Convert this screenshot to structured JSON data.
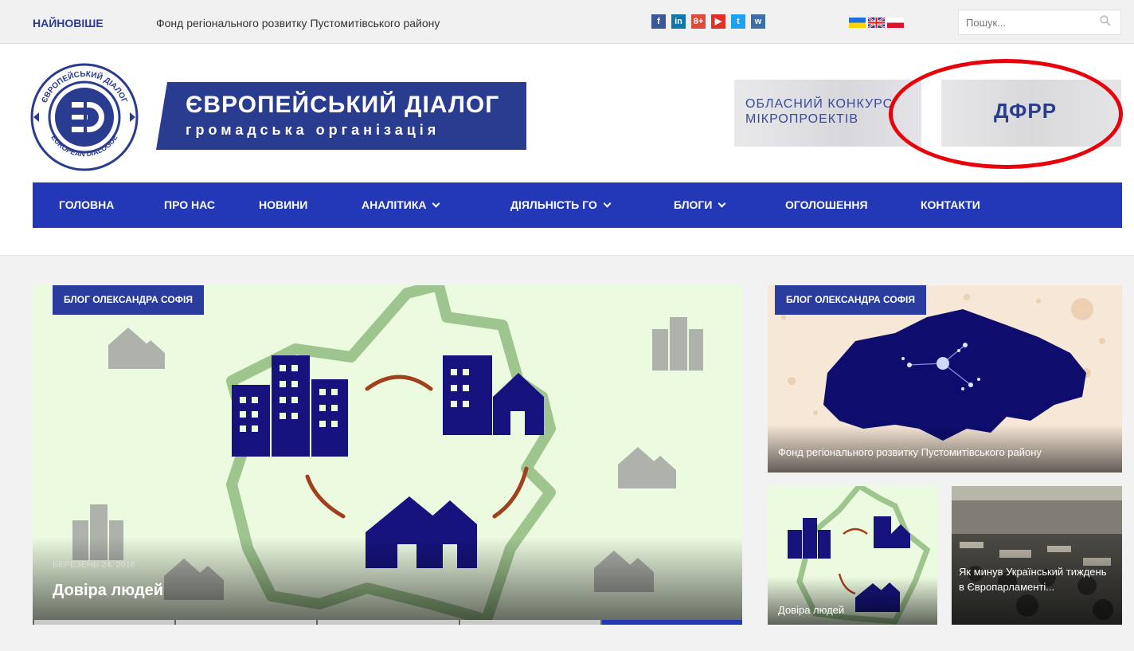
{
  "topbar": {
    "latest_label": "НАЙНОВІШЕ",
    "latest_headline": "Фонд регіонального розвитку Пустомитівського району",
    "social": [
      {
        "icon": "facebook-icon",
        "glyph": "f",
        "color": "#3b5998"
      },
      {
        "icon": "linkedin-icon",
        "glyph": "in",
        "color": "#0e76a8"
      },
      {
        "icon": "google-plus-icon",
        "glyph": "8+",
        "color": "#dd4b39"
      },
      {
        "icon": "youtube-icon",
        "glyph": "▶",
        "color": "#e52d27"
      },
      {
        "icon": "twitter-icon",
        "glyph": "t",
        "color": "#1da1f2"
      },
      {
        "icon": "vk-icon",
        "glyph": "w",
        "color": "#3e6ea7"
      }
    ],
    "flags": [
      "ukraine-flag-icon",
      "uk-flag-icon",
      "poland-flag-icon"
    ],
    "search_placeholder": "Пошук..."
  },
  "header": {
    "logo_title": "ЄВРОПЕЙСЬКИЙ ДІАЛОГ",
    "logo_subtitle": "громадська організація",
    "logo_ring_top": "ЄВРОПЕЙСЬКИЙ ДІАЛОГ",
    "logo_ring_bottom": "EUROPEAN DIALOGUE",
    "banner1": "ОБЛАСНИЙ КОНКУРС МІКРОПРОЕКТІВ",
    "banner2": "ДФРР"
  },
  "nav": {
    "items": [
      {
        "label": "ГОЛОВНА"
      },
      {
        "label": "ПРО НАС"
      },
      {
        "label": "НОВИНИ"
      },
      {
        "label": "АНАЛІТИКА"
      },
      {
        "label": "ДІЯЛЬНІСТЬ ГО"
      },
      {
        "label": "БЛОГИ"
      },
      {
        "label": "ОГОЛОШЕННЯ"
      },
      {
        "label": "КОНТАКТИ"
      }
    ]
  },
  "featured": {
    "tag": "БЛОГ ОЛЕКСАНДРА СОФІЯ",
    "date": "БЕРЕЗЕНЬ 24, 2016",
    "title": "Довіра людей",
    "slides": 5,
    "active_slide": 5
  },
  "side": {
    "top": {
      "tag": "БЛОГ ОЛЕКСАНДРА СОФІЯ",
      "title": "Фонд регіонального розвитку Пустомитівського району"
    },
    "bottom_left": {
      "title": "Довіра людей"
    },
    "bottom_right": {
      "title": "Як минув Український тиждень в Європарламенті..."
    }
  },
  "colors": {
    "brand": "#2238b6",
    "accent_ring": "#e8000b",
    "map_green": "#e9f9dc"
  }
}
